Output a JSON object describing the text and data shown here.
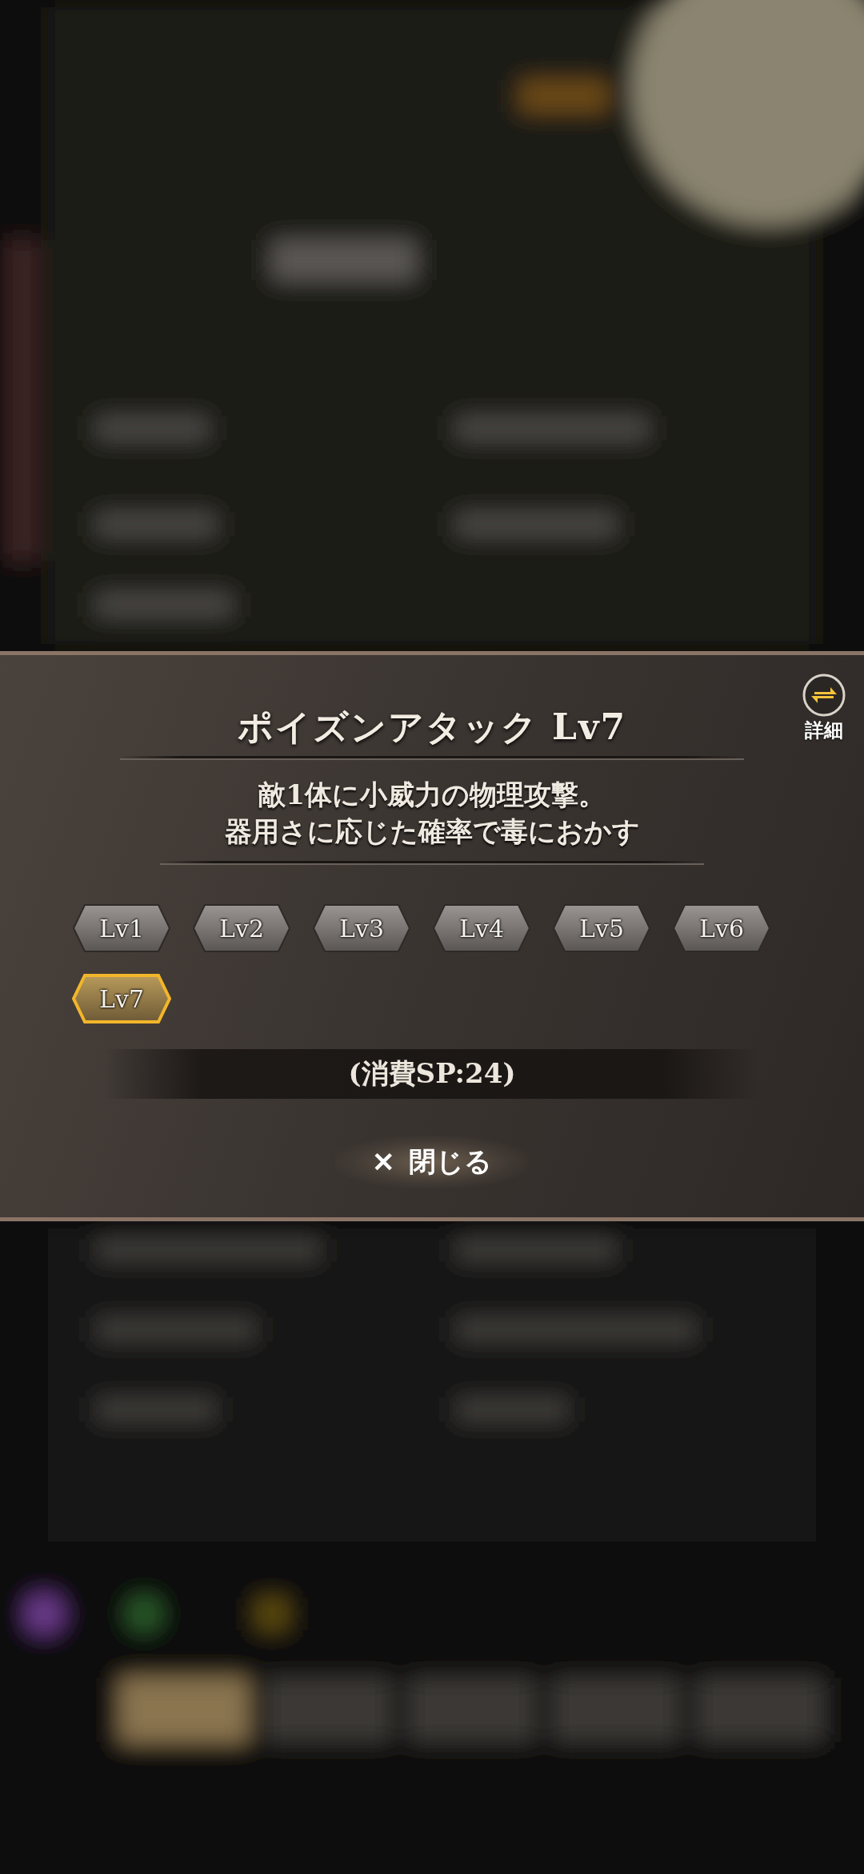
{
  "dialog": {
    "title": "ポイズンアタック Lv7",
    "detail_button": {
      "label": "詳細"
    },
    "description": [
      "敵1体に小威力の物理攻撃。",
      "器用さに応じた確率で毒におかす"
    ],
    "levels": [
      {
        "label": "Lv1",
        "selected": false
      },
      {
        "label": "Lv2",
        "selected": false
      },
      {
        "label": "Lv3",
        "selected": false
      },
      {
        "label": "Lv4",
        "selected": false
      },
      {
        "label": "Lv5",
        "selected": false
      },
      {
        "label": "Lv6",
        "selected": false
      },
      {
        "label": "Lv7",
        "selected": true
      }
    ],
    "cost": "(消費SP:24)",
    "close_button": {
      "icon": "✕",
      "label": "閉じる"
    }
  }
}
